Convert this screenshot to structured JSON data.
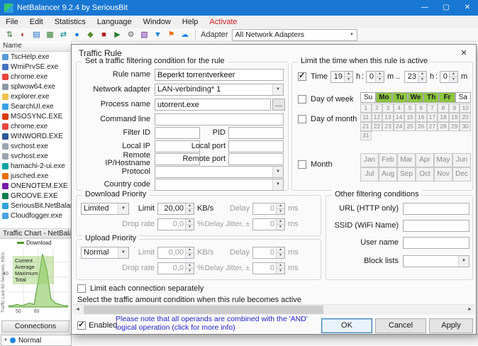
{
  "window": {
    "title": "NetBalancer 9.2.4 by SeriousBit",
    "controls": {
      "minimize": "—",
      "maximize": "▢",
      "close": "✕"
    }
  },
  "menu": {
    "items": [
      {
        "t": "File",
        "c": "#1a1a1a"
      },
      {
        "t": "Edit",
        "c": "#1a1a1a"
      },
      {
        "t": "Statistics",
        "c": "#1a1a1a"
      },
      {
        "t": "Language",
        "c": "#1a1a1a"
      },
      {
        "t": "Window",
        "c": "#1a1a1a"
      },
      {
        "t": "Help",
        "c": "#1a1a1a"
      },
      {
        "t": "Activate",
        "c": "#cc2222"
      }
    ]
  },
  "toolbar": {
    "icons": [
      {
        "dn": "priorities-icon",
        "g": "⇅",
        "c": "#2e7d32"
      },
      {
        "dn": "limits-icon",
        "g": "◐",
        "c": "#c62828"
      },
      {
        "dn": "rules-icon",
        "g": "▤",
        "c": "#1565c0"
      },
      {
        "dn": "chart-icon",
        "g": "▦",
        "c": "#2e7d32"
      },
      {
        "dn": "connections-icon",
        "g": "⇄",
        "c": "#00838f"
      },
      {
        "dn": "globe-icon",
        "g": "●",
        "c": "#1976d2"
      },
      {
        "dn": "shield-icon",
        "g": "◆",
        "c": "#558b2f"
      },
      {
        "dn": "stop-icon",
        "g": "■",
        "c": "#b71c1c"
      },
      {
        "dn": "play-icon",
        "g": "▶",
        "c": "#2e7d32"
      },
      {
        "dn": "gear-icon",
        "g": "⚙",
        "c": "#616161"
      },
      {
        "dn": "stats-icon",
        "g": "▧",
        "c": "#6a1b9a"
      },
      {
        "dn": "filter-icon",
        "g": "▼",
        "c": "#1e88e5"
      },
      {
        "dn": "flag-icon",
        "g": "⚑",
        "c": "#ef6c00"
      },
      {
        "dn": "cloud-icon",
        "g": "☁",
        "c": "#1e88e5"
      }
    ],
    "adapter_label": "Adapter",
    "adapter_value": "All Network Adapters"
  },
  "process_list": {
    "header": "Name",
    "items": [
      {
        "name": "TscHelp.exe",
        "color": "#5b9bd5"
      },
      {
        "name": "WmiPrvSE.exe",
        "color": "#4472c4"
      },
      {
        "name": "chrome.exe",
        "color": "#e8453c"
      },
      {
        "name": "splwow64.exe",
        "color": "#8d9aa5"
      },
      {
        "name": "explorer.exe",
        "color": "#f2c04a"
      },
      {
        "name": "SearchUI.exe",
        "color": "#38a1e4"
      },
      {
        "name": "MSOSYNC.EXE",
        "color": "#d83b01"
      },
      {
        "name": "chrome.exe",
        "color": "#e8453c"
      },
      {
        "name": "WINWORD.EXE",
        "color": "#2b579a"
      },
      {
        "name": "svchost.exe",
        "color": "#9aa5b1"
      },
      {
        "name": "svchost.exe",
        "color": "#9aa5b1"
      },
      {
        "name": "hamachi-2-ui.exe",
        "color": "#00a3a1"
      },
      {
        "name": "jusched.exe",
        "color": "#e76f00"
      },
      {
        "name": "ONENOTEM.EXE",
        "color": "#7719aa"
      },
      {
        "name": "GROOVE.EXE",
        "color": "#0a7c48"
      },
      {
        "name": "SeriousBit.NetBalanc",
        "color": "#2ea3dc"
      },
      {
        "name": "Cloudfogger.exe",
        "color": "#4aa3e0"
      }
    ]
  },
  "chart_panel": {
    "title": "Traffic Chart - NetBala",
    "legend": "Download",
    "stats": [
      "Current",
      "Average",
      "Maximum",
      "Total"
    ],
    "y_axis_label": "Traffic Last 60 Seconds, KB/s",
    "y_tick": "40",
    "x_ticks": [
      "50",
      "60"
    ],
    "series": [
      1,
      1,
      2,
      1,
      2,
      3,
      2,
      20,
      40,
      28,
      6,
      3,
      2,
      1,
      1
    ],
    "ymax": 45,
    "accent_color": "#4c9a2a"
  },
  "bottom": {
    "connections_label": "Connections",
    "priority_value": "Normal"
  },
  "dialog": {
    "title": "Traffic Rule",
    "filter_group": {
      "title": "Set a traffic filtering condition for the rule",
      "rule_name": {
        "label": "Rule name",
        "value": "Beperkt torrentverkeer"
      },
      "network_adapter": {
        "label": "Network adapter",
        "value": "LAN-verbinding* 1"
      },
      "process_name": {
        "label": "Process name",
        "value": "utorrent.exe",
        "browse": "..."
      },
      "command_line": {
        "label": "Command line",
        "value": ""
      },
      "filter_id": {
        "label": "Filter ID",
        "value": ""
      },
      "pid": {
        "label": "PID",
        "value": ""
      },
      "local_ip": {
        "label": "Local IP",
        "value": ""
      },
      "local_port": {
        "label": "Local port",
        "value": ""
      },
      "remote_ip": {
        "label": "Remote IP/Hostname",
        "value": ""
      },
      "remote_port": {
        "label": "Remote port",
        "value": ""
      },
      "protocol": {
        "label": "Protocol",
        "value": ""
      },
      "country_code": {
        "label": "Country code",
        "value": ""
      }
    },
    "time_group": {
      "title": "Limit the time when this rule is active",
      "time_label": "Time",
      "from_hour": "19",
      "from_min": "0",
      "to_hour": "23",
      "to_min": "0",
      "hour_unit": "h",
      "min_unit": "m",
      "colon": ":",
      "range_sep": "..",
      "day_of_week_label": "Day of week",
      "weekdays": [
        {
          "t": "Su"
        },
        {
          "t": "Mo",
          "sel": true
        },
        {
          "t": "Tu",
          "sel": true
        },
        {
          "t": "We",
          "sel": true
        },
        {
          "t": "Th",
          "sel": true
        },
        {
          "t": "Fr",
          "sel": true
        },
        {
          "t": "Sa"
        }
      ],
      "day_of_month_label": "Day of month",
      "month_days": [
        "1",
        "2",
        "3",
        "4",
        "5",
        "6",
        "7",
        "8",
        "9",
        "10",
        "11",
        "12",
        "13",
        "14",
        "15",
        "16",
        "17",
        "18",
        "19",
        "20",
        "21",
        "22",
        "23",
        "24",
        "25",
        "26",
        "27",
        "28",
        "29",
        "30",
        "31"
      ],
      "month_label": "Month",
      "months": [
        "Jan",
        "Feb",
        "Mar",
        "Apr",
        "May",
        "Jun",
        "Jul",
        "Aug",
        "Sep",
        "Oct",
        "Nov",
        "Dec"
      ]
    },
    "download": {
      "title": "Download Priority",
      "priority": "Limited",
      "limit_label": "Limit",
      "limit": "20,00",
      "limit_unit": "KB/s",
      "delay_label": "Delay",
      "delay": "0",
      "delay_unit": "ms",
      "drop_label": "Drop rate",
      "drop": "0,0",
      "drop_unit": "%",
      "jitter_label": "Delay Jitter, ±",
      "jitter": "0",
      "jitter_unit": "ms"
    },
    "upload": {
      "title": "Upload Priority",
      "priority": "Normal",
      "limit_label": "Limit",
      "limit": "0,00",
      "limit_unit": "KB/s",
      "delay_label": "Delay",
      "delay": "0",
      "delay_unit": "ms",
      "drop_label": "Drop rate",
      "drop": "0,0",
      "drop_unit": "%",
      "jitter_label": "Delay Jitter, ±",
      "jitter": "0",
      "jitter_unit": "ms"
    },
    "other_group": {
      "title": "Other filtering conditions",
      "url_label": "URL (HTTP only)",
      "url_value": "",
      "ssid_label": "SSID (WiFi Name)",
      "ssid_value": "",
      "user_label": "User name",
      "user_value": "",
      "block_label": "Block lists",
      "block_value": ""
    },
    "limit_each_label": "Limit each connection separately",
    "traffic_amount_label": "Select the traffic amount condition when this rule becomes active",
    "enabled_label": "Enabled",
    "note": "Please note that all operands are combined with the 'AND' logical operation (click for more info)",
    "buttons": {
      "ok": "OK",
      "cancel": "Cancel",
      "apply": "Apply"
    }
  }
}
